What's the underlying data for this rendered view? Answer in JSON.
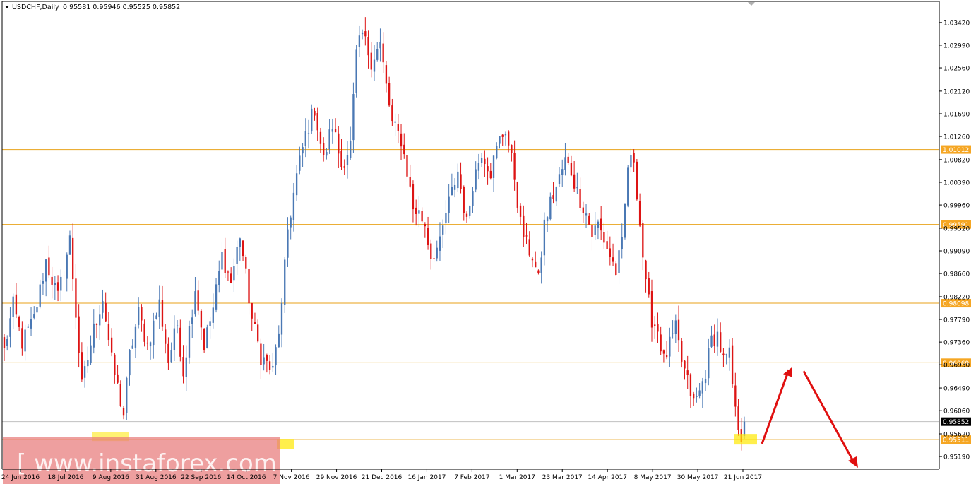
{
  "header": {
    "symbol_label": "USDCHF,Daily",
    "ohlc_text": "0.95581 0.95946 0.95525 0.95852",
    "dropdown_icon": "triangle-down-icon"
  },
  "watermark": {
    "text": "[ www.instaforex.com ]"
  },
  "colors": {
    "bull": "#4a78b4",
    "bear": "#dd1414",
    "level_line": "#e8a21a",
    "level_tag_bg": "#f5a623",
    "current_price_bg": "#000000",
    "arrow": "#e01010",
    "highlight": "#ffe800",
    "watermark_bg": "#e87a7a"
  },
  "chart_data": {
    "type": "candlestick",
    "title": "USDCHF,Daily",
    "ohlc_last": {
      "open": 0.95581,
      "high": 0.95946,
      "low": 0.95525,
      "close": 0.95852
    },
    "current_price_label": "0.95852",
    "ylim": [
      0.9495,
      1.0382
    ],
    "y_ticks": [
      "1.03420",
      "1.02990",
      "1.02560",
      "1.02120",
      "1.01690",
      "1.01260",
      "1.00820",
      "1.00390",
      "0.99960",
      "0.99520",
      "0.99090",
      "0.98660",
      "0.98220",
      "0.97790",
      "0.97360",
      "0.96930",
      "0.96490",
      "0.96060",
      "0.95620",
      "0.95190"
    ],
    "x_ticks": [
      "24 Jun 2016",
      "18 Jul 2016",
      "9 Aug 2016",
      "31 Aug 2016",
      "22 Sep 2016",
      "14 Oct 2016",
      "7 Nov 2016",
      "29 Nov 2016",
      "21 Dec 2016",
      "16 Jan 2017",
      "7 Feb 2017",
      "1 Mar 2017",
      "23 Mar 2017",
      "14 Apr 2017",
      "8 May 2017",
      "30 May 2017",
      "21 Jun 2017"
    ],
    "levels": [
      {
        "value": 1.01012,
        "label": "1.01012"
      },
      {
        "value": 0.99591,
        "label": "0.99591"
      },
      {
        "value": 0.98098,
        "label": "0.98098"
      },
      {
        "value": 0.96969,
        "label": "0.96969"
      },
      {
        "value": 0.95511,
        "label": "0.95511"
      }
    ],
    "anchors": [
      [
        0,
        0.972
      ],
      [
        3,
        0.9805
      ],
      [
        6,
        0.9735
      ],
      [
        10,
        0.978
      ],
      [
        14,
        0.989
      ],
      [
        18,
        0.982
      ],
      [
        22,
        0.993
      ],
      [
        26,
        0.965
      ],
      [
        30,
        0.976
      ],
      [
        33,
        0.982
      ],
      [
        36,
        0.97
      ],
      [
        40,
        0.96
      ],
      [
        42,
        0.971
      ],
      [
        45,
        0.979
      ],
      [
        48,
        0.973
      ],
      [
        52,
        0.981
      ],
      [
        55,
        0.97
      ],
      [
        58,
        0.977
      ],
      [
        60,
        0.968
      ],
      [
        64,
        0.984
      ],
      [
        67,
        0.973
      ],
      [
        70,
        0.98
      ],
      [
        73,
        0.99
      ],
      [
        76,
        0.985
      ],
      [
        79,
        0.994
      ],
      [
        83,
        0.978
      ],
      [
        86,
        0.971
      ],
      [
        90,
        0.968
      ],
      [
        93,
        0.98
      ],
      [
        95,
        0.995
      ],
      [
        98,
        1.005
      ],
      [
        101,
        1.013
      ],
      [
        104,
        1.018
      ],
      [
        107,
        1.008
      ],
      [
        110,
        1.015
      ],
      [
        113,
        1.007
      ],
      [
        116,
        1.011
      ],
      [
        118,
        1.028
      ],
      [
        120,
        1.032
      ],
      [
        123,
        1.027
      ],
      [
        126,
        1.03
      ],
      [
        128,
        1.022
      ],
      [
        130,
        1.015
      ],
      [
        133,
        1.012
      ],
      [
        135,
        1.006
      ],
      [
        137,
        0.999
      ],
      [
        139,
        0.998
      ],
      [
        141,
        0.996
      ],
      [
        143,
        0.99
      ],
      [
        146,
        0.992
      ],
      [
        148,
        0.998
      ],
      [
        150,
        1.002
      ],
      [
        152,
        1.006
      ],
      [
        155,
        0.996
      ],
      [
        157,
        1.004
      ],
      [
        160,
        1.01
      ],
      [
        163,
        1.006
      ],
      [
        166,
        1.012
      ],
      [
        168,
        1.014
      ],
      [
        171,
        1.005
      ],
      [
        173,
        0.996
      ],
      [
        175,
        0.992
      ],
      [
        177,
        0.99
      ],
      [
        179,
        0.985
      ],
      [
        181,
        0.996
      ],
      [
        183,
        1.0
      ],
      [
        185,
        1.003
      ],
      [
        188,
        1.008
      ],
      [
        190,
        1.006
      ],
      [
        192,
        1.002
      ],
      [
        195,
        0.998
      ],
      [
        197,
        0.994
      ],
      [
        199,
        0.996
      ],
      [
        201,
        0.993
      ],
      [
        203,
        0.99
      ],
      [
        205,
        0.987
      ],
      [
        207,
        0.992
      ],
      [
        209,
        1.007
      ],
      [
        211,
        1.0085
      ],
      [
        213,
        0.996
      ],
      [
        215,
        0.984
      ],
      [
        217,
        0.978
      ],
      [
        219,
        0.976
      ],
      [
        221,
        0.97
      ],
      [
        223,
        0.973
      ],
      [
        225,
        0.976
      ],
      [
        227,
        0.97
      ],
      [
        229,
        0.966
      ],
      [
        231,
        0.962
      ],
      [
        233,
        0.964
      ],
      [
        235,
        0.968
      ],
      [
        237,
        0.974
      ],
      [
        239,
        0.975
      ],
      [
        241,
        0.97
      ],
      [
        243,
        0.971
      ],
      [
        245,
        0.96
      ],
      [
        247,
        0.956
      ],
      [
        248,
        0.95852
      ]
    ],
    "annotations": [
      {
        "type": "arrow",
        "description": "projected rise from support toward 0.96969 level"
      },
      {
        "type": "arrow",
        "description": "projected fall below 0.95190"
      },
      {
        "type": "highlight",
        "description": "support touch points near 0.95511"
      }
    ]
  }
}
